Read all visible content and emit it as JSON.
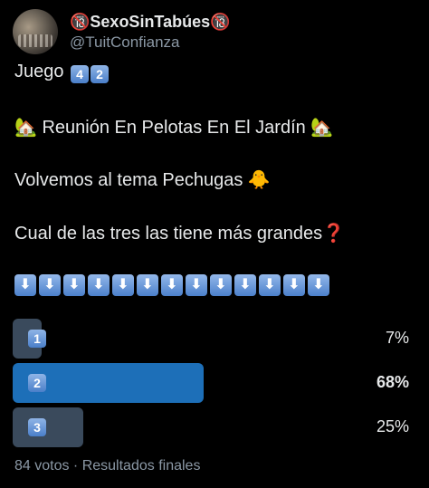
{
  "author": {
    "display_name": "🔞SexoSinTabúes🔞",
    "username": "@TuitConfianza"
  },
  "tweet": {
    "line1_text": "Juego",
    "line1_keys": [
      "4",
      "2"
    ],
    "line2": "🏡 Reunión En Pelotas En El Jardín 🏡",
    "line3": "Volvemos al tema Pechugas 🐥",
    "line4": "Cual de las tres las tiene más grandes❓",
    "arrows": [
      "⬇",
      "⬇",
      "⬇",
      "⬇",
      "⬇",
      "⬇",
      "⬇",
      "⬇",
      "⬇",
      "⬇",
      "⬇",
      "⬇",
      "⬇"
    ]
  },
  "poll": {
    "options": [
      {
        "label": "1",
        "percent": "7%",
        "fraction": 0.07,
        "winner": false
      },
      {
        "label": "2",
        "percent": "68%",
        "fraction": 0.68,
        "winner": true
      },
      {
        "label": "3",
        "percent": "25%",
        "fraction": 0.25,
        "winner": false
      }
    ],
    "footer": "84 votos · Resultados finales"
  },
  "colors": {
    "winner_bar": "#1d6fb8",
    "loser_bar": "#3a4a5c",
    "muted_text": "#8b98a5"
  }
}
